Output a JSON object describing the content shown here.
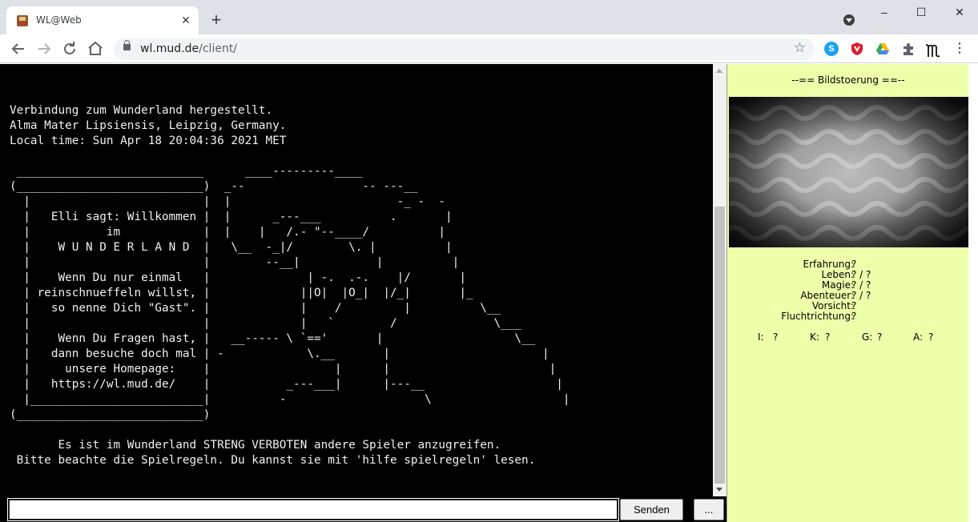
{
  "browser": {
    "tab_title": "WL@Web",
    "tab_close": "✕",
    "new_tab": "+",
    "url_host": "wl.mud.de",
    "url_path": "/client/",
    "win_min": "–",
    "win_max": "☐",
    "win_close": "✕",
    "icons": [
      "back-icon",
      "forward-icon",
      "reload-icon",
      "home-icon",
      "lock-icon",
      "bookmark-star-icon",
      "skype-icon",
      "shield-icon",
      "drive-icon",
      "extensions-icon",
      "profile-icon",
      "menu-icon"
    ]
  },
  "terminal": {
    "text": "\nVerbindung zum Wunderland hergestellt.\nAlma Mater Lipsiensis, Leipzig, Germany.\nLocal time: Sun Apr 18 20:04:36 2021 MET\n\n ___________________________      ____---------____\n(___________________________)  _--                 -- ---__\n  |                         |  |                        -_ -  -\n  |   Elli sagt: Willkommen |  |      _---___          .       |\n  |           im            |  |    |   /.- \"--____/          |\n  |    W U N D E R L A N D  |   \\__  -_|/        \\. |          |\n  |                         |        --__|           |          |\n  |    Wenn Du nur einmal   |              | -.  .-.    |/       |\n  | reinschnueffeln willst, |             ||O|  |O_|  |/_|       |_\n  |   so nenne Dich \"Gast\". |             |    /         |          \\__\n  |                         |             |   `        /              \\___\n  |    Wenn Du Fragen hast, |   __----- \\ `=='       |                   \\__\n  |   dann besuche doch mal | -            \\.__       |                      |\n  |     unsere Homepage:    |                  |      |                       |\n  |   https://wl.mud.de/    |           _---___|      |---__                   |\n  |_________________________|          -                    \\                   |\n(___________________________)\n\n       Es ist im Wunderland STRENG VERBOTEN andere Spieler anzugreifen.\n Bitte beachte die Spielregeln. Du kannst sie mit 'hilfe spielregeln' lesen.\n\n\nWie heisst Du denn ('h' fuer eine Hilfe)?"
  },
  "input": {
    "value": "",
    "send_label": "Senden",
    "more_label": "..."
  },
  "panel": {
    "title": "--== Bildstoerung ==--",
    "stats": [
      {
        "label": "Erfahrung:",
        "value": "?"
      },
      {
        "label": "Leben:",
        "value": "? / ?"
      },
      {
        "label": "Magie:",
        "value": "? / ?"
      },
      {
        "label": "Abenteuer:",
        "value": "? / ?"
      },
      {
        "label": "Vorsicht:",
        "value": "?"
      },
      {
        "label": "Fluchtrichtung:",
        "value": "?"
      }
    ],
    "attrs": [
      {
        "key": "I:",
        "value": "?"
      },
      {
        "key": "K:",
        "value": "?"
      },
      {
        "key": "G:",
        "value": "?"
      },
      {
        "key": "A:",
        "value": "?"
      }
    ]
  },
  "colors": {
    "terminal_bg": "#000000",
    "terminal_fg": "#f0f0f0",
    "panel_bg": "#eeffaa"
  }
}
